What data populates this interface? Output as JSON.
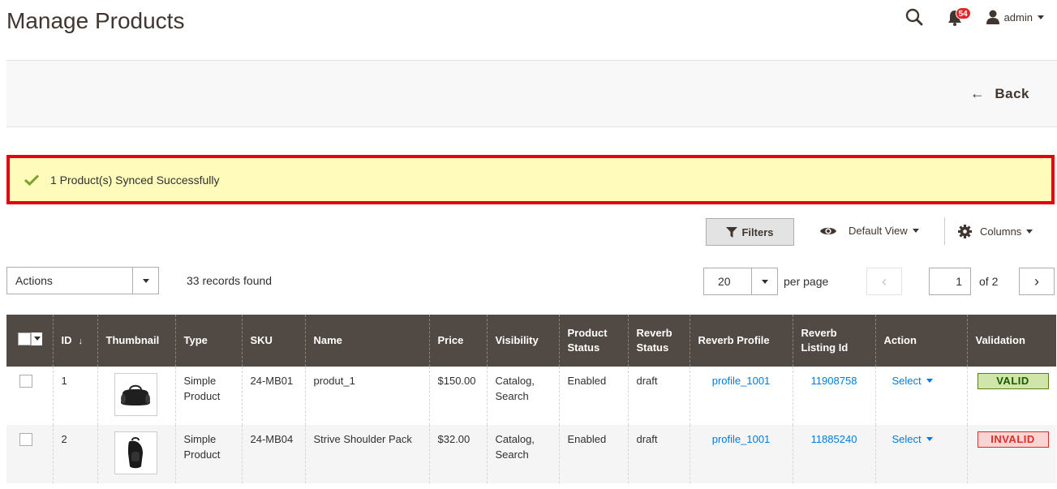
{
  "page": {
    "title": "Manage Products"
  },
  "header": {
    "notifications_count": "54",
    "user_name": "admin"
  },
  "actionbar": {
    "back_label": "Back",
    "back_arrow": "←"
  },
  "message": {
    "text": "1 Product(s) Synced Successfully"
  },
  "toolbar": {
    "filters_label": "Filters",
    "view_label": "Default View",
    "columns_label": "Columns",
    "actions_label": "Actions",
    "records_found": "33 records found",
    "per_page_value": "20",
    "per_page_label": "per page",
    "current_page": "1",
    "page_of": "of 2",
    "prev_glyph": "‹",
    "next_glyph": "›"
  },
  "table": {
    "columns": [
      "ID",
      "Thumbnail",
      "Type",
      "SKU",
      "Name",
      "Price",
      "Visibility",
      "Product Status",
      "Reverb Status",
      "Reverb Profile",
      "Reverb Listing Id",
      "Action",
      "Validation"
    ],
    "sort_arrow": "↓",
    "rows": [
      {
        "id": "1",
        "type": "Simple Product",
        "sku": "24-MB01",
        "name": "produt_1",
        "price": "$150.00",
        "visibility": "Catalog, Search",
        "product_status": "Enabled",
        "reverb_status": "draft",
        "reverb_profile": "profile_1001",
        "listing_id": "11908758",
        "action": "Select",
        "validation": "VALID"
      },
      {
        "id": "2",
        "type": "Simple Product",
        "sku": "24-MB04",
        "name": "Strive Shoulder Pack",
        "price": "$32.00",
        "visibility": "Catalog, Search",
        "product_status": "Enabled",
        "reverb_status": "draft",
        "reverb_profile": "profile_1001",
        "listing_id": "11885240",
        "action": "Select",
        "validation": "INVALID"
      }
    ]
  },
  "colors": {
    "header_bg": "#514943",
    "link": "#007bdb",
    "message_bg": "#fffbbb",
    "message_border": "#e5000f",
    "valid_bg": "#d0e5a9",
    "invalid_bg": "#f9d4d4"
  }
}
